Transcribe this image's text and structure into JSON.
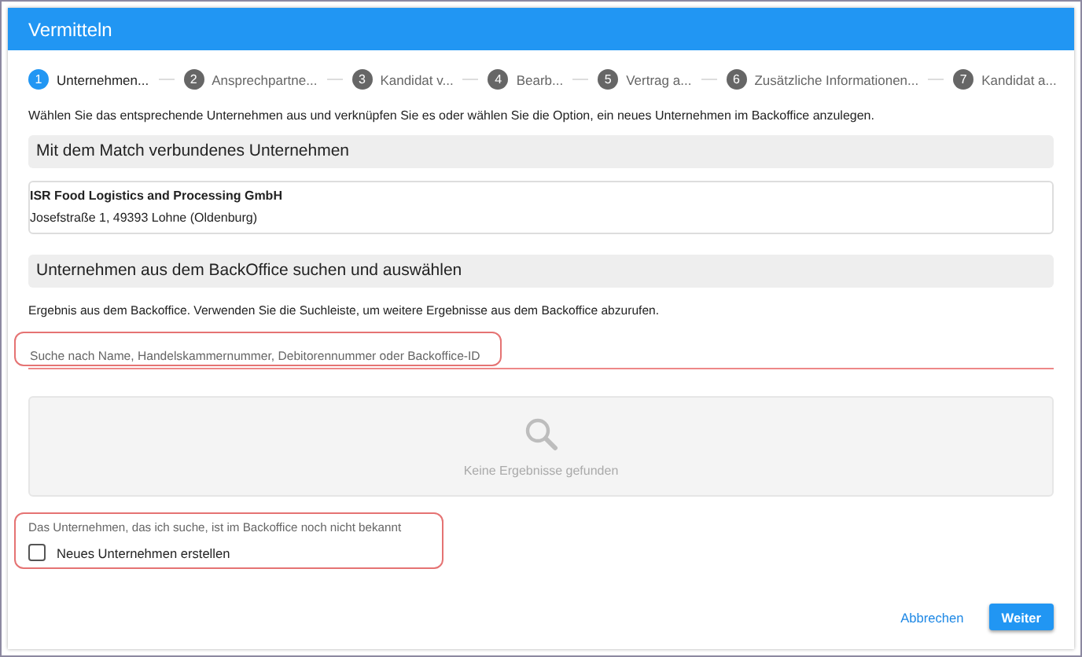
{
  "dialog": {
    "title": "Vermitteln"
  },
  "steps": [
    {
      "number": "1",
      "label": "Unternehmen...",
      "selected": true
    },
    {
      "number": "2",
      "label": "Ansprechpartne...",
      "selected": false
    },
    {
      "number": "3",
      "label": "Kandidat v...",
      "selected": false
    },
    {
      "number": "4",
      "label": "Bearb...",
      "selected": false
    },
    {
      "number": "5",
      "label": "Vertrag a...",
      "selected": false
    },
    {
      "number": "6",
      "label": "Zusätzliche Informationen...",
      "selected": false
    },
    {
      "number": "7",
      "label": "Kandidat a...",
      "selected": false
    }
  ],
  "intro": "Wählen Sie das entsprechende Unternehmen aus und verknüpfen Sie es oder wählen Sie die Option, ein neues Unternehmen im Backoffice anzulegen.",
  "matched_section": {
    "heading": "Mit dem Match verbundenes Unternehmen",
    "company_name": "ISR Food Logistics and Processing GmbH",
    "address": "Josefstraße 1, 49393 Lohne (Oldenburg)"
  },
  "search_section": {
    "heading": "Unternehmen aus dem BackOffice suchen und auswählen",
    "hint": "Ergebnis aus dem Backoffice. Verwenden Sie die Suchleiste, um weitere Ergebnisse aus dem Backoffice abzurufen.",
    "search": {
      "placeholder": "Suche nach Name, Handelskammernummer, Debitorennummer oder Backoffice-ID"
    },
    "empty_text": "Keine Ergebnisse gefunden"
  },
  "new_company": {
    "note": "Das Unternehmen, das ich suche, ist im Backoffice noch nicht bekannt",
    "checkbox": {
      "label": "Neues Unternehmen erstellen",
      "checked": false
    }
  },
  "buttons": [
    {
      "label": "Abbrechen",
      "kind": "text"
    },
    {
      "label": "Weiter",
      "kind": "primary"
    }
  ]
}
